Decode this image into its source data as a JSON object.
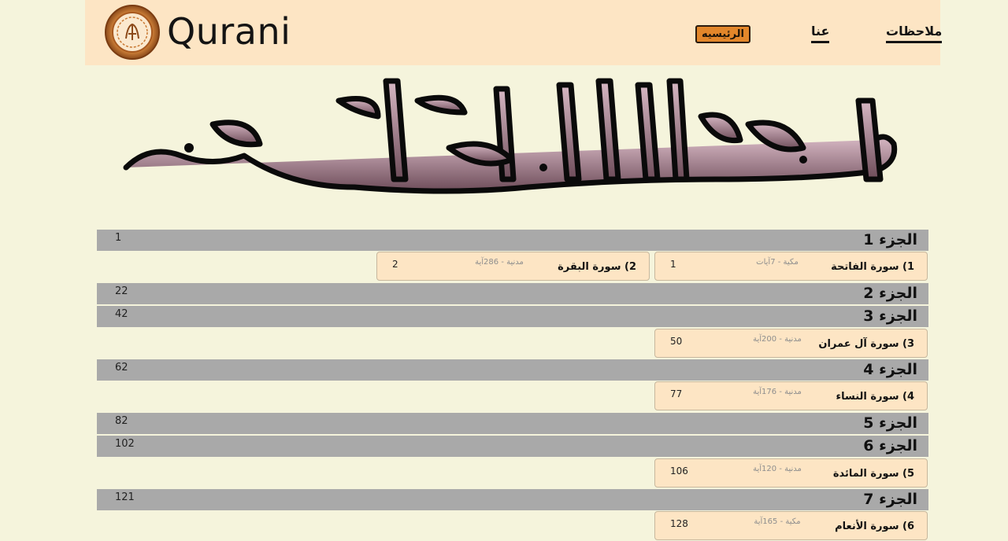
{
  "header": {
    "brand": "Qurani",
    "nav": {
      "home": "الرئيسيه",
      "about": "عنا",
      "notes": "ملاحظات"
    }
  },
  "banner": {
    "alt": "بسم الله الرحمن الرحيم"
  },
  "juz": [
    {
      "title": "الجزء 1",
      "page": "1"
    },
    {
      "title": "الجزء 2",
      "page": "22"
    },
    {
      "title": "الجزء 3",
      "page": "42"
    },
    {
      "title": "الجزء 4",
      "page": "62"
    },
    {
      "title": "الجزء 5",
      "page": "82"
    },
    {
      "title": "الجزء 6",
      "page": "102"
    },
    {
      "title": "الجزء 7",
      "page": "121"
    }
  ],
  "surahs": [
    {
      "name": "1) سورة الفاتحة",
      "meta": "مكية - 7آيات",
      "page": "1"
    },
    {
      "name": "2) سورة البقرة",
      "meta": "مدنية - 286آية",
      "page": "2"
    },
    {
      "name": "3) سورة آل عمران",
      "meta": "مدنية - 200آية",
      "page": "50"
    },
    {
      "name": "4) سورة النساء",
      "meta": "مدنية - 176آية",
      "page": "77"
    },
    {
      "name": "5) سورة المائدة",
      "meta": "مدنية - 120آية",
      "page": "106"
    },
    {
      "name": "6) سورة الأنعام",
      "meta": "مكية - 165آية",
      "page": "128"
    }
  ],
  "colors": {
    "background": "#f5f4dc",
    "header": "#fde5c4",
    "accent": "#e2862a",
    "juz_bar": "#a9a9a9"
  }
}
